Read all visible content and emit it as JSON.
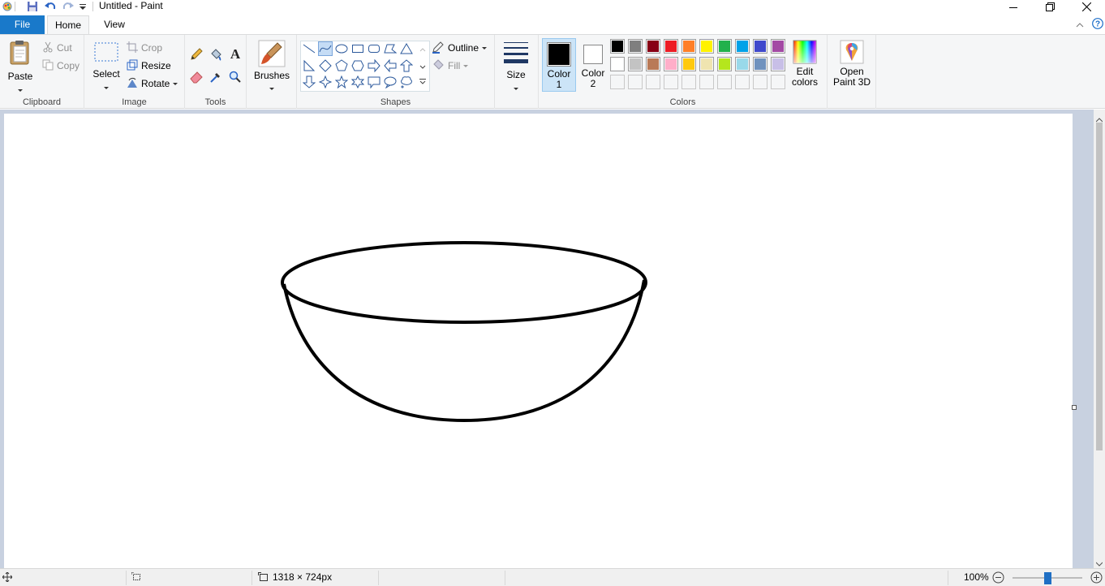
{
  "window": {
    "title": "Untitled - Paint"
  },
  "tabs": {
    "file": "File",
    "home": "Home",
    "view": "View"
  },
  "clipboard": {
    "paste": "Paste",
    "cut": "Cut",
    "copy": "Copy",
    "label": "Clipboard"
  },
  "image": {
    "select": "Select",
    "crop": "Crop",
    "resize": "Resize",
    "rotate": "Rotate",
    "label": "Image"
  },
  "tools": {
    "label": "Tools"
  },
  "brushes": {
    "label": "Brushes"
  },
  "shapes": {
    "outline": "Outline",
    "fill": "Fill",
    "label": "Shapes"
  },
  "size": {
    "label": "Size"
  },
  "colors": {
    "color1_line1": "Color",
    "color1_line2": "1",
    "color2_line1": "Color",
    "color2_line2": "2",
    "edit_line1": "Edit",
    "edit_line2": "colors",
    "label": "Colors",
    "color1_value": "#000000",
    "color2_value": "#ffffff",
    "palette_row1": [
      "#000000",
      "#7f7f7f",
      "#880015",
      "#ed1c24",
      "#ff7f27",
      "#fff200",
      "#22b14c",
      "#00a2e8",
      "#3f48cc",
      "#a349a4"
    ],
    "palette_row2": [
      "#ffffff",
      "#c3c3c3",
      "#b97a57",
      "#ffaec9",
      "#ffc90e",
      "#efe4b0",
      "#b5e61d",
      "#99d9ea",
      "#7092be",
      "#c8bfe7"
    ]
  },
  "paint3d": {
    "line1": "Open",
    "line2": "Paint 3D"
  },
  "status": {
    "dimensions": "1318 × 724px",
    "zoom": "100%",
    "zoom_level": 100
  }
}
